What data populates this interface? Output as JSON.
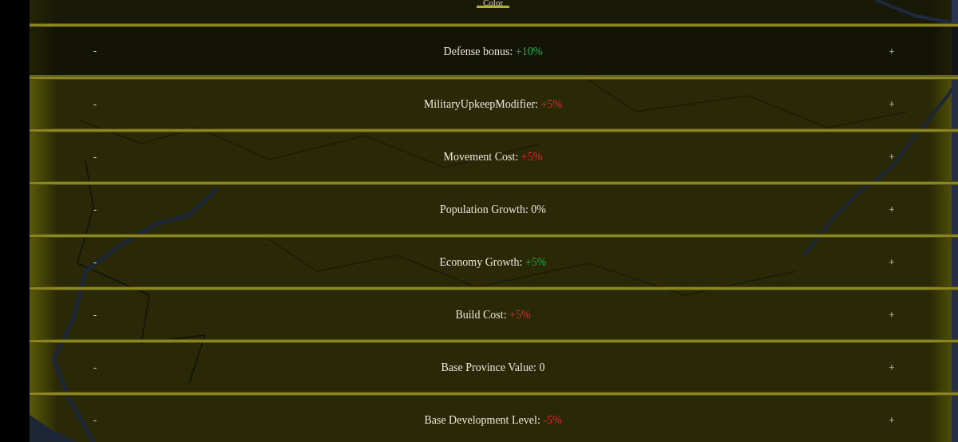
{
  "header_tab": {
    "label": "Color",
    "selected": true
  },
  "modifiers": [
    {
      "label": "Defense bonus:",
      "value": "+10%",
      "color": "#22b43f",
      "selected": true,
      "decrease": "-",
      "increase": "+"
    },
    {
      "label": "MilitaryUpkeepModifier:",
      "value": "+5%",
      "color": "#e8282c",
      "selected": false,
      "decrease": "-",
      "increase": "+"
    },
    {
      "label": "Movement Cost:",
      "value": "+5%",
      "color": "#e8282c",
      "selected": false,
      "decrease": "-",
      "increase": "+"
    },
    {
      "label": "Population Growth:",
      "value": "0%",
      "color": "#e8e4d8",
      "selected": false,
      "decrease": "-",
      "increase": "+"
    },
    {
      "label": "Economy Growth:",
      "value": "+5%",
      "color": "#1fa83a",
      "selected": false,
      "decrease": "-",
      "increase": "+"
    },
    {
      "label": "Build Cost:",
      "value": "+5%",
      "color": "#e8282c",
      "selected": false,
      "decrease": "-",
      "increase": "+"
    },
    {
      "label": "Base Province Value:",
      "value": "0",
      "color": "#e8e4d8",
      "selected": false,
      "decrease": "-",
      "increase": "+"
    },
    {
      "label": "Base Development Level:",
      "value": "-5%",
      "color": "#e8282c",
      "selected": false,
      "decrease": "-",
      "increase": "+"
    }
  ]
}
